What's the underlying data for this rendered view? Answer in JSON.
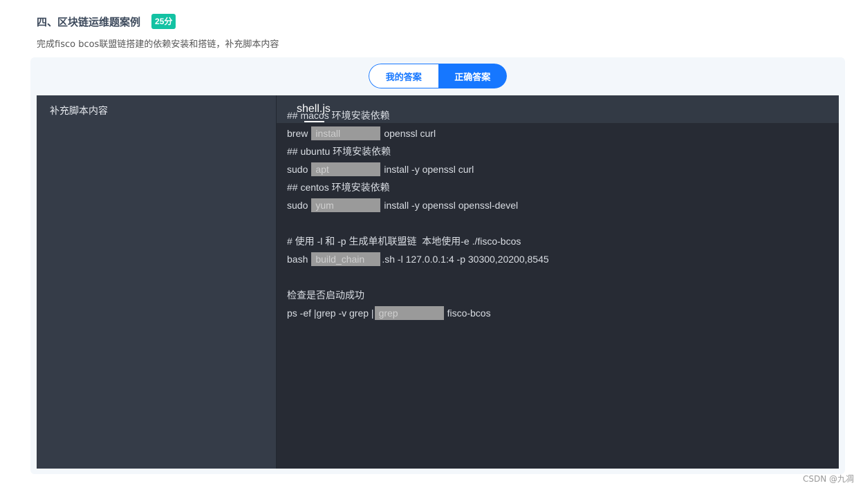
{
  "question": {
    "title": "四、区块链运维题案例",
    "score": "25分",
    "description": "完成fisco bcos联盟链搭建的依赖安装和搭链，补充脚本内容"
  },
  "tabs": {
    "my_answer": "我的答案",
    "correct_answer": "正确答案",
    "active": "correct_answer"
  },
  "left_pane": {
    "title": "补充脚本内容"
  },
  "file_tab": {
    "name": "shell.js"
  },
  "code": {
    "l1": "## macos 环境安装依赖",
    "l2_pre": "brew",
    "l2_blank": "install",
    "l2_post": "openssl curl",
    "l3": "## ubuntu 环境安装依赖",
    "l4_pre": "sudo",
    "l4_blank": "apt",
    "l4_post": "install -y openssl curl",
    "l5": "## centos 环境安装依赖",
    "l6_pre": "sudo",
    "l6_blank": "yum",
    "l6_post": "install -y openssl openssl-devel",
    "l8": "# 使用 -l 和 -p 生成单机联盟链  本地使用-e ./fisco-bcos",
    "l9_pre": "bash",
    "l9_blank": "build_chain",
    "l9_post": ".sh -l 127.0.0.1:4 -p 30300,20200,8545",
    "l11": "检查是否启动成功",
    "l12_pre": "ps -ef |grep -v grep |",
    "l12_blank": "grep",
    "l12_post": "fisco-bcos"
  },
  "watermark": "CSDN @九凋",
  "colors": {
    "accent": "#1677ff",
    "score_badge": "#13c2a3",
    "editor_bg": "#272b34"
  }
}
